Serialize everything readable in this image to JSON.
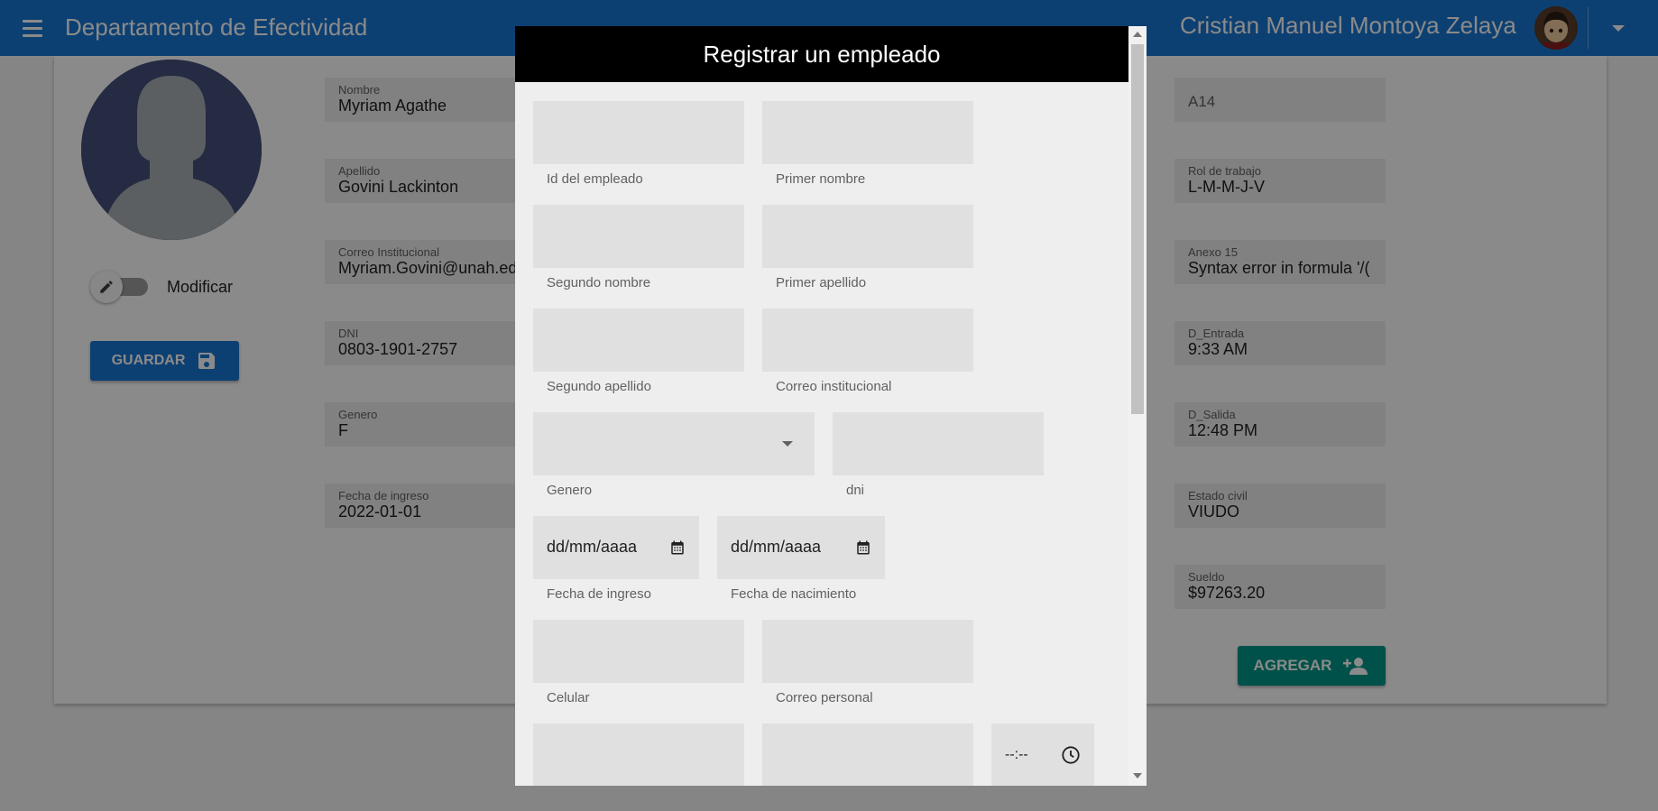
{
  "app": {
    "title": "Departamento de Efectividad",
    "user_name": "Cristian Manuel Montoya Zelaya"
  },
  "toggle": {
    "label": "Modificar"
  },
  "buttons": {
    "save_label": "GUARDAR",
    "add_label": "AGREGAR"
  },
  "left_fields": [
    {
      "label": "Nombre",
      "value": "Myriam Agathe"
    },
    {
      "label": "Apellido",
      "value": "Govini Lackinton"
    },
    {
      "label": "Correo Institucional",
      "value": "Myriam.Govini@unah.edu"
    },
    {
      "label": "DNI",
      "value": "0803-1901-2757"
    },
    {
      "label": "Genero",
      "value": "F"
    },
    {
      "label": "Fecha de ingreso",
      "value": "2022-01-01"
    }
  ],
  "right_fields": [
    {
      "label": "",
      "value": "A14"
    },
    {
      "label": "Rol de trabajo",
      "value": "L-M-M-J-V"
    },
    {
      "label": "Anexo 15",
      "value": "Syntax error in formula '/("
    },
    {
      "label": "D_Entrada",
      "value": "9:33 AM"
    },
    {
      "label": "D_Salida",
      "value": "12:48 PM"
    },
    {
      "label": "Estado civil",
      "value": "VIUDO"
    },
    {
      "label": "Sueldo",
      "value": "$97263.20"
    }
  ],
  "modal": {
    "title": "Registrar un empleado",
    "fields": {
      "id": "Id del empleado",
      "primer_nombre": "Primer nombre",
      "segundo_nombre": "Segundo nombre",
      "primer_apellido": "Primer apellido",
      "segundo_apellido": "Segundo apellido",
      "correo_institucional": "Correo institucional",
      "genero": "Genero",
      "dni": "dni",
      "fecha_ingreso": "Fecha de ingreso",
      "fecha_nacimiento": "Fecha de nacimiento",
      "celular": "Celular",
      "correo_personal": "Correo personal"
    },
    "date_placeholder": "dd/mm/aaaa",
    "time_placeholder": "--:--"
  },
  "icons": {
    "menu": "menu-icon",
    "save": "floppy-disk-icon",
    "add": "person-add-icon",
    "edit": "pencil-icon",
    "calendar": "calendar-icon",
    "clock": "clock-icon"
  },
  "colors": {
    "primary": "#1976d2",
    "accent": "#009688",
    "modal_header": "#000000"
  }
}
